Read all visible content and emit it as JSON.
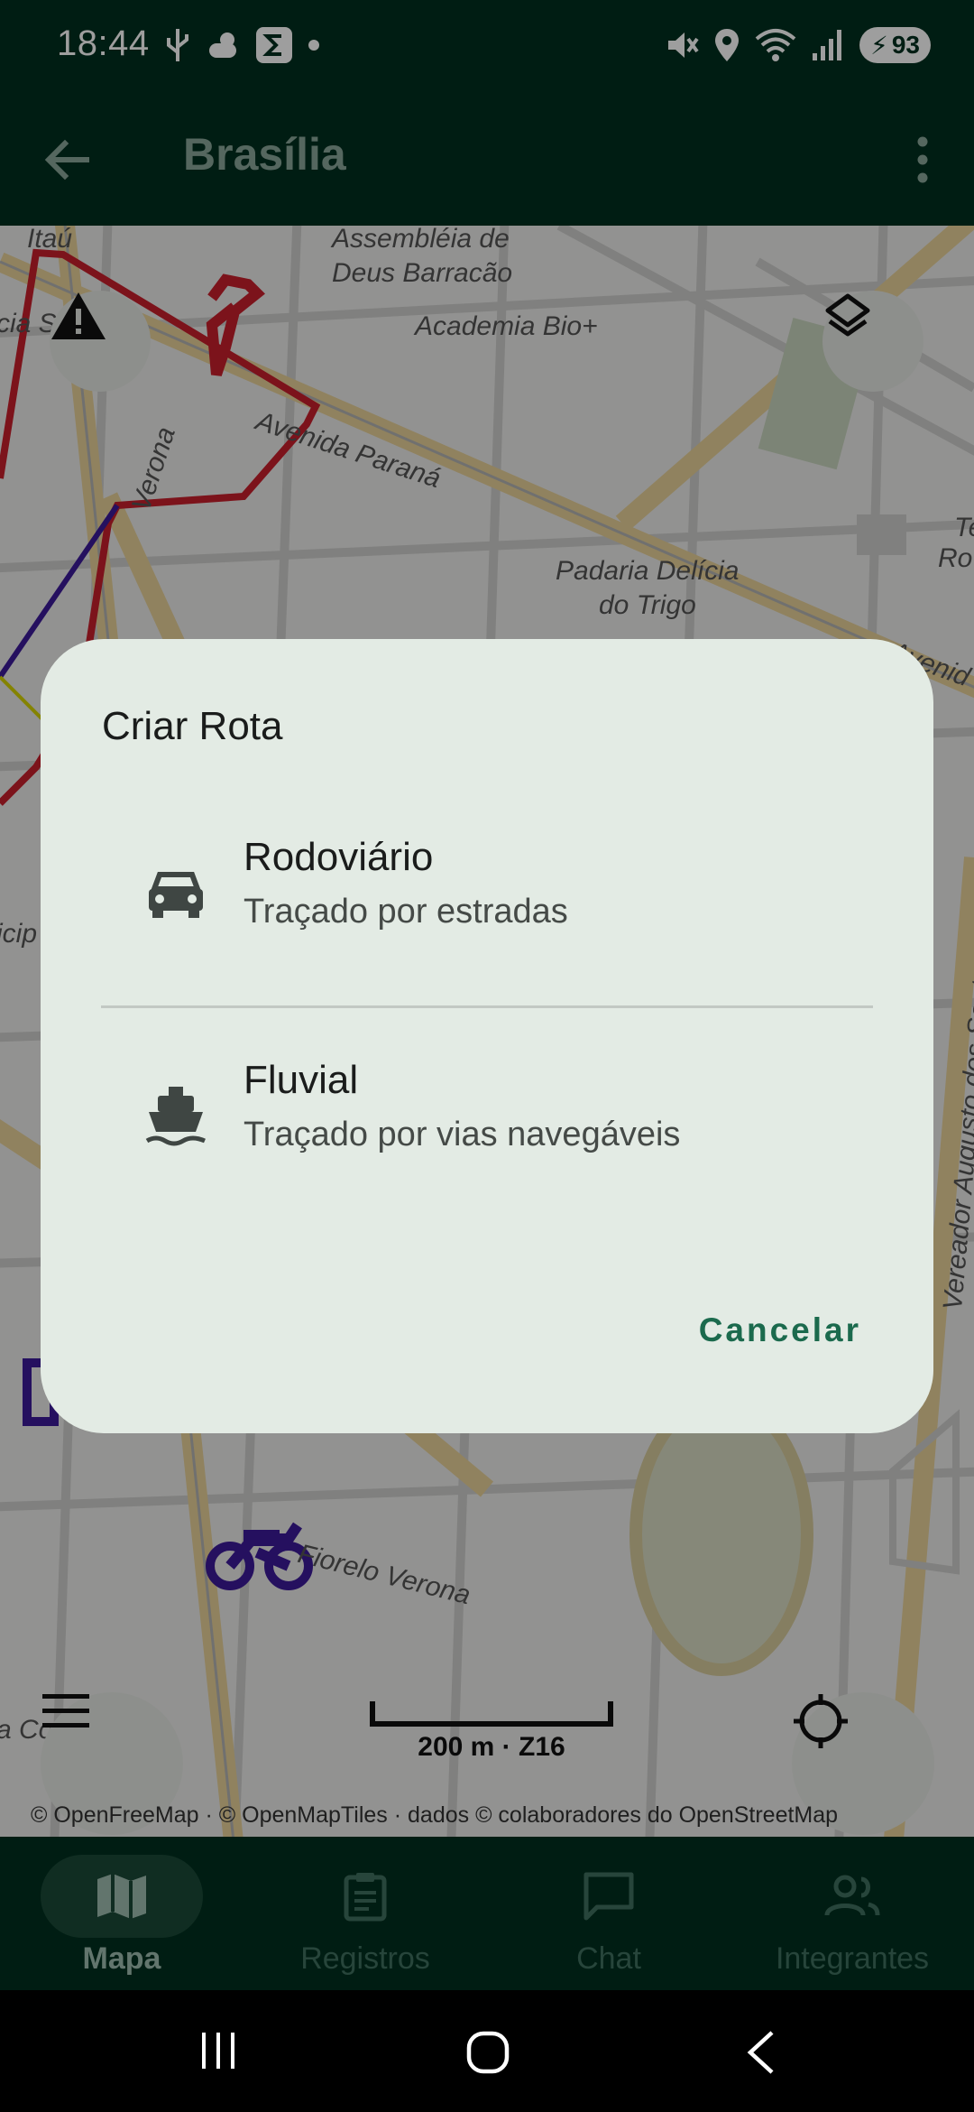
{
  "status_bar": {
    "time": "18:44",
    "battery": "93"
  },
  "app_bar": {
    "title": "Brasília"
  },
  "map": {
    "labels": [
      "Itaú",
      "Assembléia de",
      "Deus Barracão",
      "Academia Bio+",
      "Avenida Paraná",
      "Verona",
      "Padaria Delícia",
      "do Trigo",
      "Avenid",
      "Te",
      "Ro",
      "Vereador Augusto dos Santos",
      "Fiorelo Verona",
      "cia S",
      "icip",
      "a Co"
    ],
    "scale": "200 m · Z16",
    "attribution": "© OpenFreeMap · © OpenMapTiles · dados © colaboradores do OpenStreetMap"
  },
  "dialog": {
    "title": "Criar Rota",
    "options": [
      {
        "title": "Rodoviário",
        "subtitle": "Traçado por estradas",
        "icon": "car-icon"
      },
      {
        "title": "Fluvial",
        "subtitle": "Traçado por vias navegáveis",
        "icon": "boat-icon"
      }
    ],
    "cancel": "Cancelar"
  },
  "bottom_nav": {
    "items": [
      {
        "label": "Mapa",
        "icon": "map-icon",
        "active": true
      },
      {
        "label": "Registros",
        "icon": "clipboard-icon",
        "active": false
      },
      {
        "label": "Chat",
        "icon": "chat-icon",
        "active": false
      },
      {
        "label": "Integrantes",
        "icon": "group-icon",
        "active": false
      }
    ]
  },
  "colors": {
    "primary_dark": "#00301f",
    "dialog_bg": "#e3ebe4",
    "accent": "#1b6a4d"
  }
}
